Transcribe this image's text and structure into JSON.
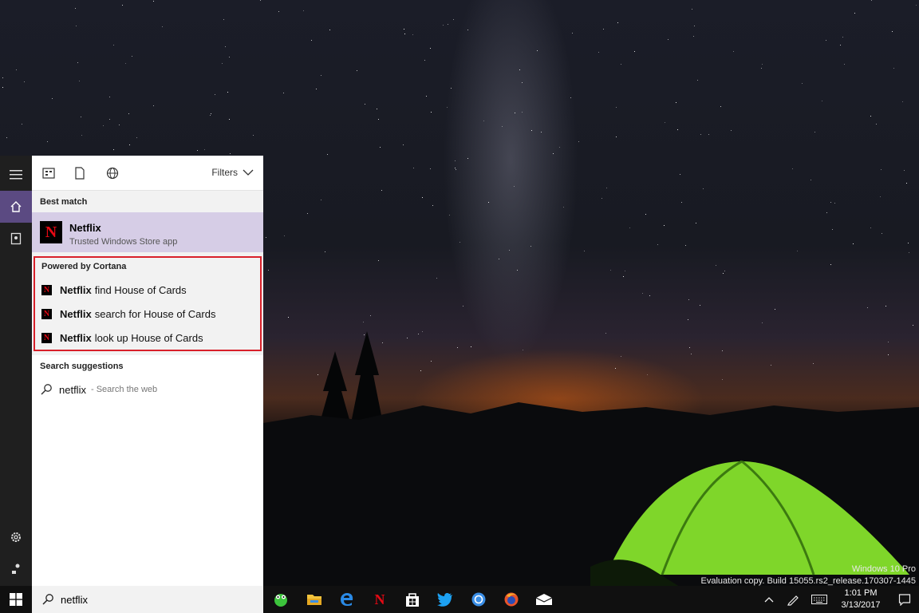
{
  "desktop": {
    "watermark_line1": "Windows 10 Pro",
    "watermark_line2": "Evaluation copy. Build 15055.rs2_release.170307-1445"
  },
  "rail": {
    "icons": [
      "hamburger-icon",
      "home-icon",
      "notebook-icon",
      "gear-icon",
      "feedback-icon"
    ]
  },
  "search_panel": {
    "toolbar": {
      "icons": [
        "apps-icon",
        "document-icon",
        "globe-icon"
      ],
      "filters_label": "Filters"
    },
    "best_match": {
      "label": "Best match",
      "title": "Netflix",
      "subtitle": "Trusted Windows Store app",
      "icon_letter": "N"
    },
    "cortana": {
      "label": "Powered by Cortana",
      "items": [
        {
          "app": "Netflix",
          "text": "find House of Cards"
        },
        {
          "app": "Netflix",
          "text": "search for House of Cards"
        },
        {
          "app": "Netflix",
          "text": "look up House of Cards"
        }
      ]
    },
    "suggestions": {
      "label": "Search suggestions",
      "query": "netflix",
      "hint": "- Search the web"
    }
  },
  "taskbar": {
    "search_value": "netflix",
    "apps": [
      "frog-app-icon",
      "file-explorer-icon",
      "edge-icon",
      "netflix-icon",
      "store-icon",
      "twitter-icon",
      "chat-icon",
      "firefox-icon",
      "mail-icon"
    ],
    "clock_time": "1:01 PM",
    "clock_date": "3/13/2017"
  },
  "colors": {
    "accent": "#5b4a82",
    "best_match_bg": "#d6cde6",
    "highlight_border": "#d8202a",
    "netflix_red": "#e50914"
  }
}
